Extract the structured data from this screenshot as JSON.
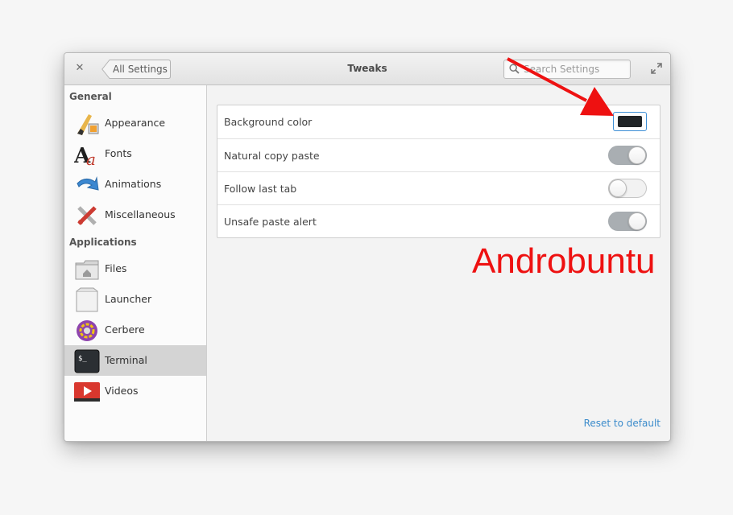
{
  "window": {
    "title": "Tweaks",
    "back_label": "All Settings",
    "search_placeholder": "Search Settings"
  },
  "sidebar": {
    "sections": [
      {
        "header": "General",
        "items": [
          {
            "label": "Appearance",
            "icon": "appearance-brush-icon"
          },
          {
            "label": "Fonts",
            "icon": "fonts-icon"
          },
          {
            "label": "Animations",
            "icon": "animations-arrow-icon"
          },
          {
            "label": "Miscellaneous",
            "icon": "miscellaneous-tools-icon"
          }
        ]
      },
      {
        "header": "Applications",
        "items": [
          {
            "label": "Files",
            "icon": "folder-icon"
          },
          {
            "label": "Launcher",
            "icon": "launcher-icon"
          },
          {
            "label": "Cerbere",
            "icon": "cerbere-icon"
          },
          {
            "label": "Terminal",
            "icon": "terminal-icon",
            "selected": true
          },
          {
            "label": "Videos",
            "icon": "videos-icon"
          }
        ]
      }
    ]
  },
  "settings": {
    "rows": [
      {
        "label": "Background color",
        "control": "color",
        "value": "#1f2326"
      },
      {
        "label": "Natural copy paste",
        "control": "switch",
        "on": true
      },
      {
        "label": "Follow last tab",
        "control": "switch",
        "on": false
      },
      {
        "label": "Unsafe paste alert",
        "control": "switch",
        "on": true
      }
    ],
    "reset_label": "Reset to default"
  },
  "overlay": {
    "watermark": "Androbuntu",
    "arrow_color": "#ee1111"
  }
}
